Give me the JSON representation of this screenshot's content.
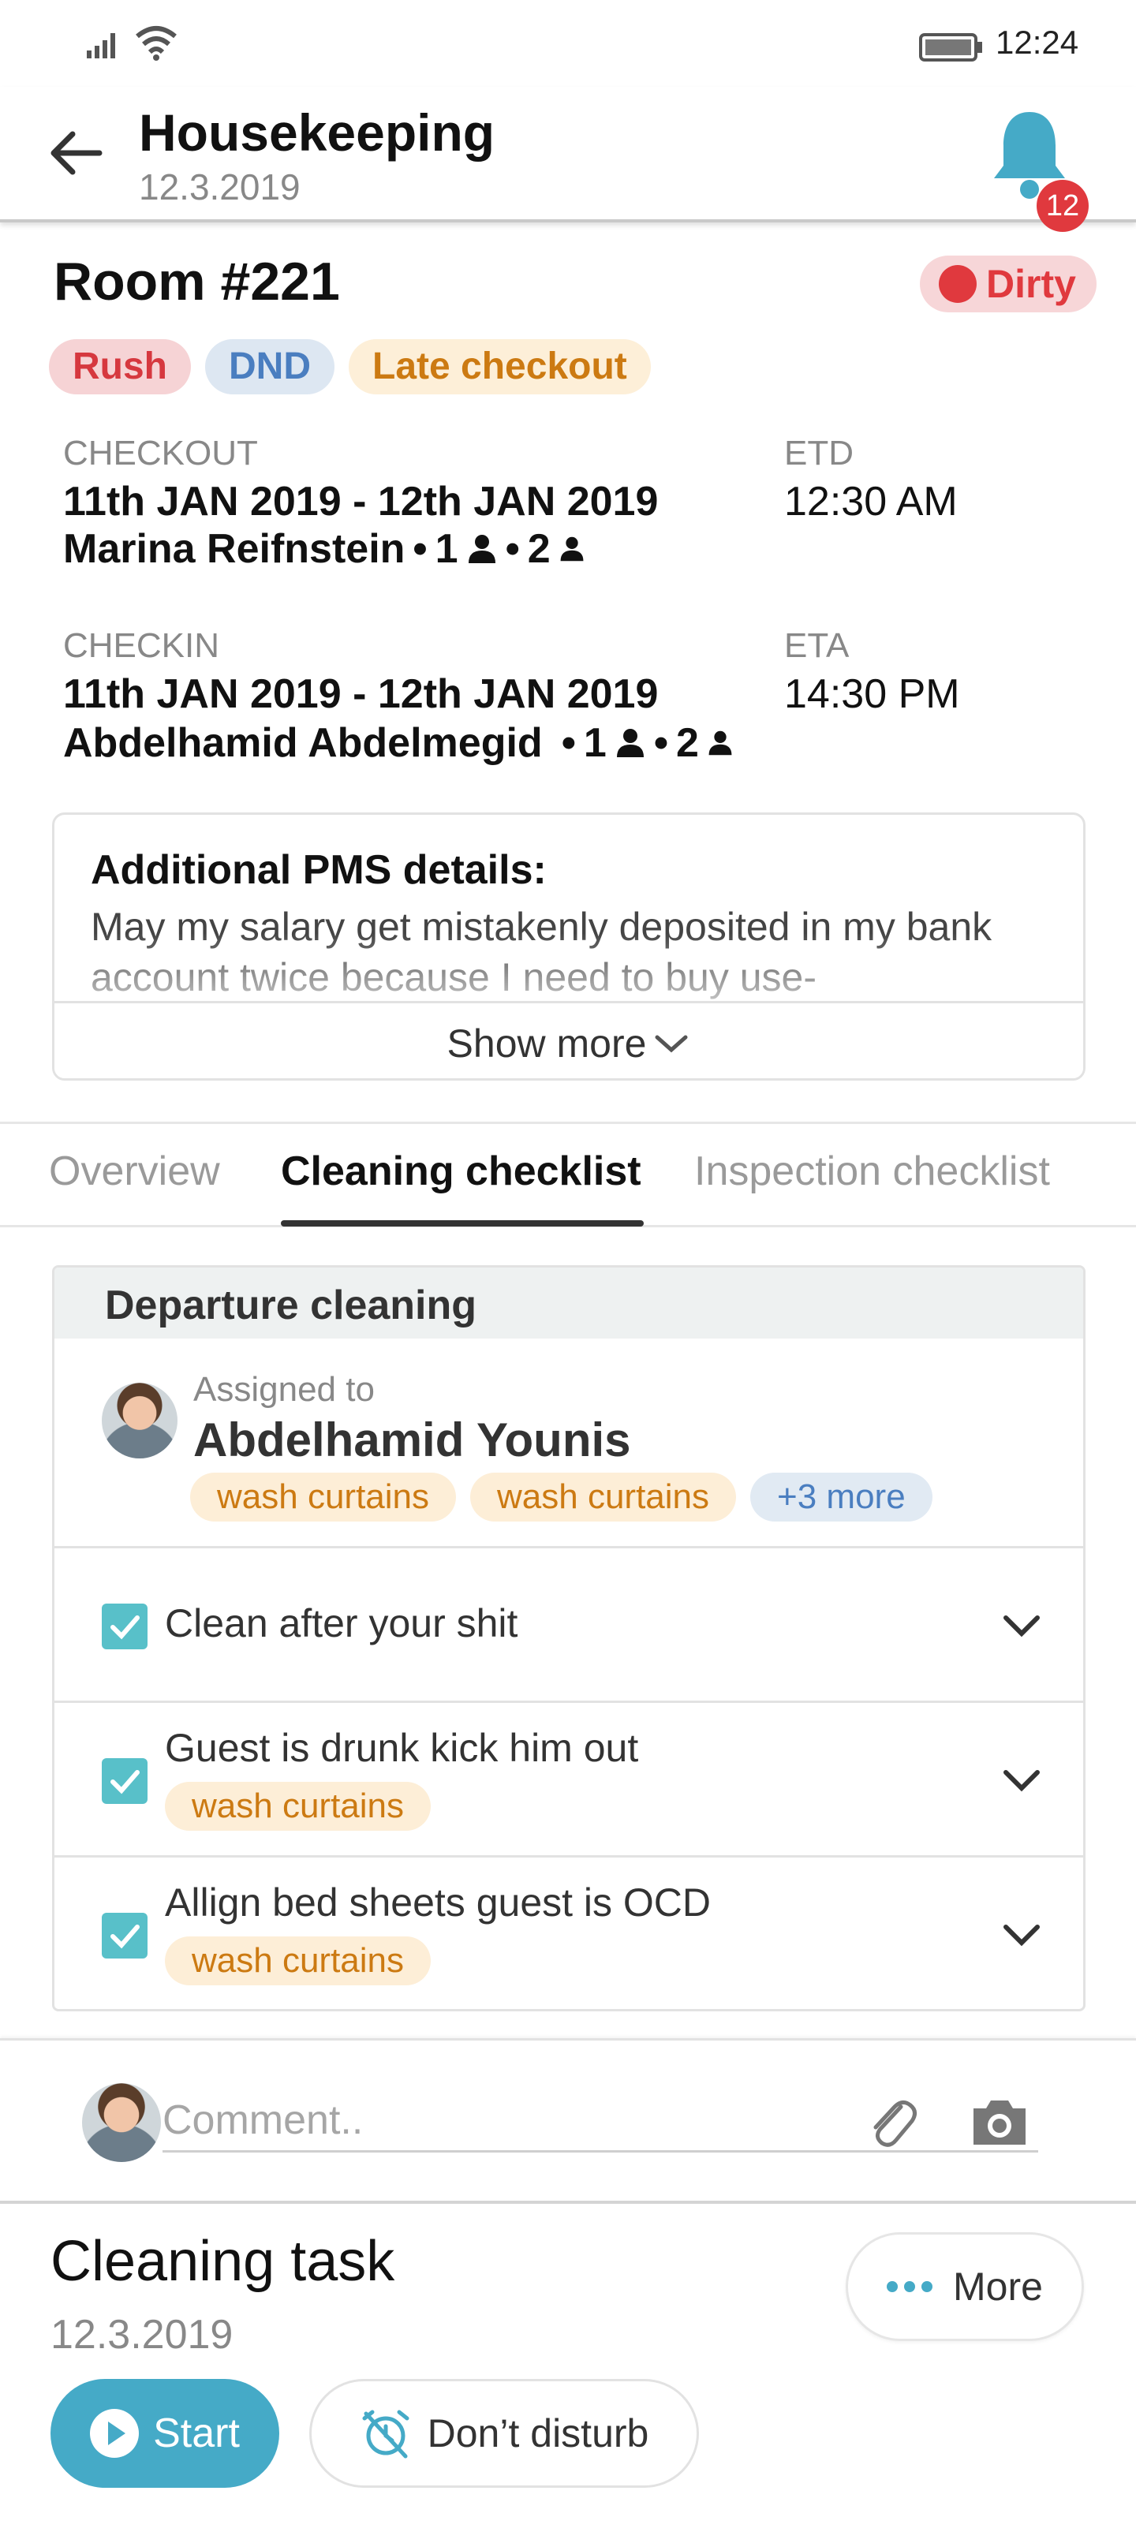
{
  "status_bar": {
    "time": "12:24"
  },
  "header": {
    "title": "Housekeeping",
    "date": "12.3.2019",
    "notification_count": "12"
  },
  "room": {
    "title": "Room #221",
    "status": "Dirty",
    "tags": [
      "Rush",
      "DND",
      "Late checkout"
    ]
  },
  "checkout": {
    "label": "CHECKOUT",
    "dates": "11th JAN 2019 - 12th JAN 2019",
    "guest": "Marina Reifnstein",
    "adults": "1",
    "children": "2",
    "etd_label": "ETD",
    "etd": "12:30 AM"
  },
  "checkin": {
    "label": "CHECKIN",
    "dates": "11th JAN 2019 - 12th JAN 2019",
    "guest": "Abdelhamid Abdelmegid",
    "adults": "1",
    "children": "2",
    "eta_label": "ETA",
    "eta": "14:30 PM"
  },
  "pms": {
    "title": "Additional PMS details:",
    "text": "May my salary get mistakenly deposited in my bank account twice because I need to buy use-",
    "show_more": "Show more"
  },
  "tabs": [
    "Overview",
    "Cleaning checklist",
    "Inspection checklist"
  ],
  "checklist": {
    "section_title": "Departure cleaning",
    "assigned_label": "Assigned to",
    "assignee": "Abdelhamid Younis",
    "assignee_tags": [
      "wash curtains",
      "wash curtains"
    ],
    "more_tag": "+3 more",
    "items": [
      {
        "text": "Clean after your shit",
        "tag": ""
      },
      {
        "text": "Guest is drunk kick him out",
        "tag": "wash curtains"
      },
      {
        "text": "Allign bed sheets guest is OCD",
        "tag": "wash curtains"
      }
    ]
  },
  "comment": {
    "placeholder": "Comment.."
  },
  "task": {
    "title": "Cleaning task",
    "date": "12.3.2019",
    "more_label": "More",
    "start_label": "Start",
    "dnd_label": "Don’t disturb"
  },
  "colors": {
    "accent": "#45aac7",
    "dirty": "#e0393e",
    "warn": "#cc7a12",
    "info": "#4a7ec0",
    "checkbox": "#58c0c9"
  }
}
